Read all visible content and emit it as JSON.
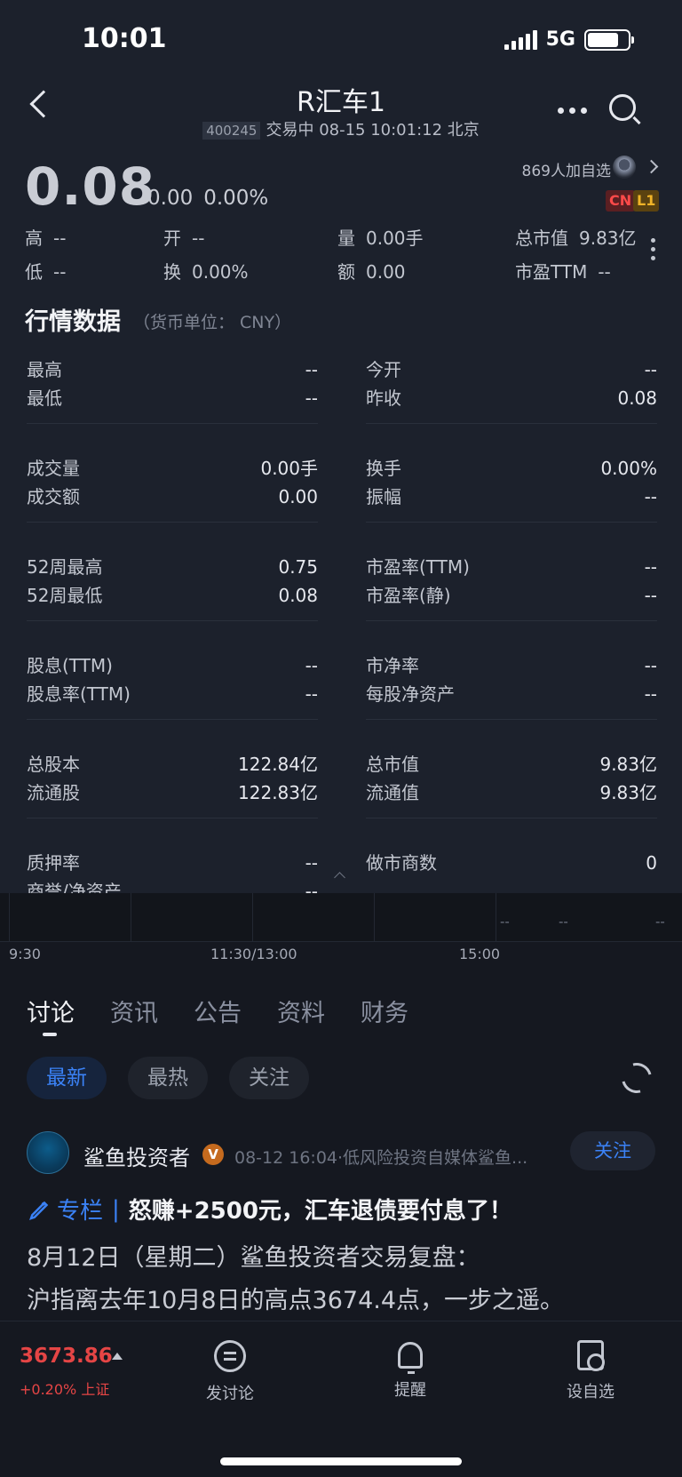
{
  "status_bar": {
    "time": "10:01",
    "network": "5G"
  },
  "header": {
    "title": "R汇车1",
    "stock_code": "400245",
    "trade_status": "交易中 08-15 10:01:12 北京"
  },
  "quote": {
    "price": "0.08",
    "change": "0.00",
    "change_pct": "0.00%",
    "watch_count": "869人加自选",
    "badges": [
      "CN",
      "L1"
    ],
    "row1": [
      {
        "label": "高",
        "value": "--"
      },
      {
        "label": "开",
        "value": "--"
      },
      {
        "label": "量",
        "value": "0.00手"
      },
      {
        "label": "总市值",
        "value": "9.83亿"
      }
    ],
    "row2": [
      {
        "label": "低",
        "value": "--"
      },
      {
        "label": "换",
        "value": "0.00%"
      },
      {
        "label": "额",
        "value": "0.00"
      },
      {
        "label": "市盈TTM",
        "value": "--"
      }
    ]
  },
  "market_data": {
    "title": "行情数据",
    "unit": "（货币单位： CNY）",
    "groups": [
      {
        "left": [
          {
            "k": "最高",
            "v": "--"
          },
          {
            "k": "最低",
            "v": "--"
          }
        ],
        "right": [
          {
            "k": "今开",
            "v": "--"
          },
          {
            "k": "昨收",
            "v": "0.08"
          }
        ]
      },
      {
        "left": [
          {
            "k": "成交量",
            "v": "0.00手"
          },
          {
            "k": "成交额",
            "v": "0.00"
          }
        ],
        "right": [
          {
            "k": "换手",
            "v": "0.00%"
          },
          {
            "k": "振幅",
            "v": "--"
          }
        ]
      },
      {
        "left": [
          {
            "k": "52周最高",
            "v": "0.75"
          },
          {
            "k": "52周最低",
            "v": "0.08"
          }
        ],
        "right": [
          {
            "k": "市盈率(TTM)",
            "v": "--"
          },
          {
            "k": "市盈率(静)",
            "v": "--"
          }
        ]
      },
      {
        "left": [
          {
            "k": "股息(TTM)",
            "v": "--"
          },
          {
            "k": "股息率(TTM)",
            "v": "--"
          }
        ],
        "right": [
          {
            "k": "市净率",
            "v": "--"
          },
          {
            "k": "每股净资产",
            "v": "--"
          }
        ]
      },
      {
        "left": [
          {
            "k": "总股本",
            "v": "122.84亿"
          },
          {
            "k": "流通股",
            "v": "122.83亿"
          }
        ],
        "right": [
          {
            "k": "总市值",
            "v": "9.83亿"
          },
          {
            "k": "流通值",
            "v": "9.83亿"
          }
        ]
      },
      {
        "left": [
          {
            "k": "质押率",
            "v": "--"
          },
          {
            "k": "商誉/净资产",
            "v": "--"
          }
        ],
        "right": [
          {
            "k": "做市商数",
            "v": "0"
          }
        ]
      }
    ]
  },
  "mini_chart": {
    "dashes": [
      "--",
      "--",
      "--"
    ],
    "time_labels": [
      "9:30",
      "11:30/13:00",
      "15:00"
    ]
  },
  "tabs": [
    "讨论",
    "资讯",
    "公告",
    "资料",
    "财务"
  ],
  "filters": [
    "最新",
    "最热",
    "关注"
  ],
  "post": {
    "author": "鲨鱼投资者",
    "verified": "V",
    "meta": "08-12 16:04·低风险投资自媒体鲨鱼...",
    "follow": "关注",
    "column_tag": "专栏",
    "title": "怒赚+2500元，汇车退债要付息了！",
    "body_line1": "8月12日（星期二）鲨鱼投资者交易复盘：",
    "body_line2": "沪指离去年10月8日的高点3674.4点，一步之遥。"
  },
  "bottom_bar": {
    "index_value": "3673.86",
    "index_change": "+0.20% 上证",
    "items": [
      "发讨论",
      "提醒",
      "设自选"
    ]
  },
  "colors": {
    "accent": "#3b82f6",
    "down_up_red": "#e54545",
    "badge_cn": "#ff4a4a",
    "badge_l1": "#f0b428"
  }
}
